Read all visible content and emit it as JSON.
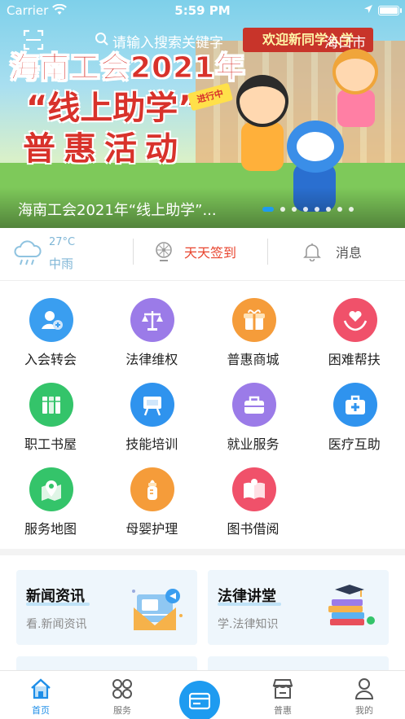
{
  "status_bar": {
    "carrier": "Carrier",
    "time": "5:59 PM"
  },
  "search": {
    "placeholder": "请输入搜索关键字",
    "city": "海口市"
  },
  "banner": {
    "caption": "海南工会2021年“线上助学”...",
    "art_line1": "海南工会2021年",
    "art_line2": "“线上助学”",
    "art_badge": "进行中",
    "art_line3": "普惠活动",
    "art_sign": "欢迎新同学入学",
    "pages": 8,
    "active_page": 1
  },
  "info_bar": {
    "weather": {
      "temperature": "27°C",
      "condition": "中雨",
      "icon": "rain-cloud-icon"
    },
    "checkin_label": "天天签到",
    "message_label": "消息"
  },
  "services": [
    {
      "label": "入会转会",
      "icon": "user-plus-icon",
      "color": "#3a9ef0"
    },
    {
      "label": "法律维权",
      "icon": "scales-icon",
      "color": "#9b7be8"
    },
    {
      "label": "普惠商城",
      "icon": "gift-icon",
      "color": "#f59c3a"
    },
    {
      "label": "困难帮扶",
      "icon": "heart-hands-icon",
      "color": "#f0516a"
    },
    {
      "label": "职工书屋",
      "icon": "books-icon",
      "color": "#34c46a"
    },
    {
      "label": "技能培训",
      "icon": "easel-icon",
      "color": "#2f93ee"
    },
    {
      "label": "就业服务",
      "icon": "briefcase-icon",
      "color": "#9b7be8"
    },
    {
      "label": "医疗互助",
      "icon": "medical-kit-icon",
      "color": "#2f93ee"
    },
    {
      "label": "服务地图",
      "icon": "map-pin-icon",
      "color": "#34c46a"
    },
    {
      "label": "母婴护理",
      "icon": "baby-bottle-icon",
      "color": "#f59c3a"
    },
    {
      "label": "图书借阅",
      "icon": "open-book-icon",
      "color": "#f0516a"
    }
  ],
  "cards": [
    {
      "title": "新闻资讯",
      "subtitle": "看.新闻资讯",
      "icon": "newspaper-icon"
    },
    {
      "title": "法律讲堂",
      "subtitle": "学.法律知识",
      "icon": "graduation-books-icon"
    }
  ],
  "tabbar": {
    "tabs": [
      {
        "label": "首页",
        "icon": "home-icon",
        "active": true
      },
      {
        "label": "服务",
        "icon": "grid-services-icon",
        "active": false
      },
      {
        "label": "",
        "icon": "card-icon",
        "active": false
      },
      {
        "label": "普惠",
        "icon": "store-icon",
        "active": false
      },
      {
        "label": "我的",
        "icon": "person-icon",
        "active": false
      }
    ],
    "active_color": "#1e8ee8"
  }
}
